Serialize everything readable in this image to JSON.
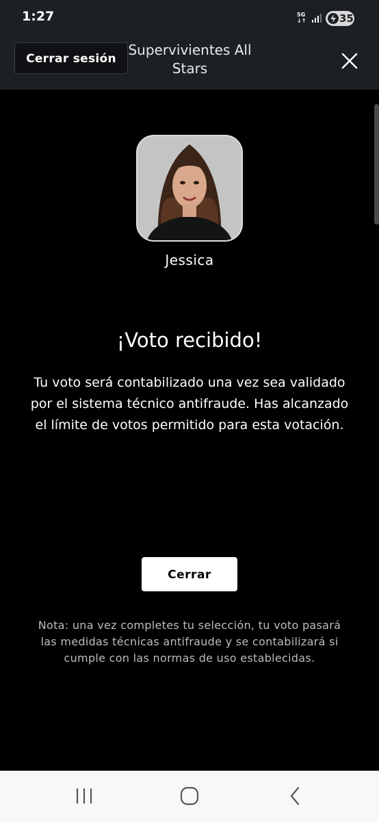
{
  "status_bar": {
    "time": "1:27",
    "network": "5G",
    "battery": "35",
    "icons": [
      "signal-icon",
      "battery-charging-icon"
    ]
  },
  "header": {
    "logout_label": "Cerrar sesión",
    "title": "Supervivientes All Stars",
    "close_icon": "close-icon"
  },
  "contestant": {
    "name": "Jessica",
    "avatar_icon": "contestant-photo"
  },
  "confirmation": {
    "title": "¡Voto recibido!",
    "message": "Tu voto será contabilizado una vez sea validado por el sistema técnico antifraude. Has alcanzado el límite de votos permitido para esta votación.",
    "close_label": "Cerrar",
    "note": "Nota: una vez completes tu selección, tu voto pasará las medidas técnicas antifraude y se contabilizará si cumple con las normas de uso establecidas."
  },
  "nav_bar": {
    "icons": [
      "recent-apps-icon",
      "home-icon",
      "back-icon"
    ]
  },
  "colors": {
    "background": "#000000",
    "header": "#1c2025",
    "button_bg": "#ffffff",
    "note_text": "#bdbdbd"
  }
}
